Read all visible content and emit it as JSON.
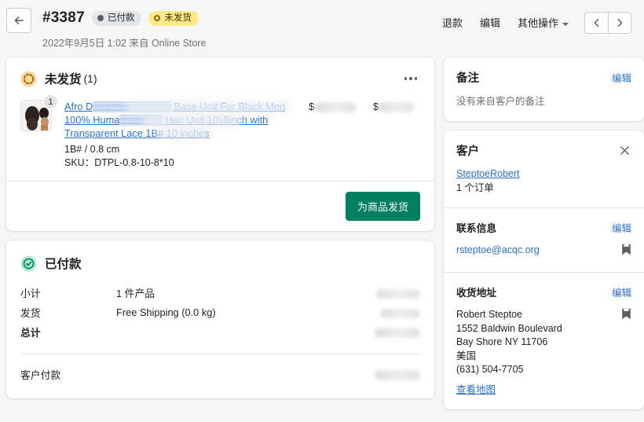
{
  "header": {
    "back_label": "返回",
    "order_number": "#3387",
    "badge_paid": "已付款",
    "badge_unfulfilled": "未发货",
    "date_line": "2022年9月5日 1:02 来自 Online Store",
    "actions": {
      "refund": "退款",
      "edit": "编辑",
      "more": "其他操作"
    },
    "prev_label": "上一个订单",
    "next_label": "下一个订单"
  },
  "fulfillment": {
    "title": "未发货",
    "count": "(1)",
    "status_icon": "dashed-circle-icon",
    "more_icon": "ellipsis-icon",
    "item": {
      "title": "Afro D▒▒▒▒▒▒▒▒▒▒▒ Base Unit For Black Men 100% Huma▒▒▒▒▒▒ Hair Unit 10x8inch with Transparent Lace 1B# 10 inches",
      "variant": "1B# / 0.8 cm",
      "sku": "SKU：DTPL-0.8-10-8*10",
      "quantity": "1",
      "price_currency": "$",
      "price_value": "",
      "total_currency": "$",
      "total_value": ""
    },
    "fulfill_button": "为商品发货"
  },
  "paid": {
    "title": "已付款",
    "status_icon": "check-circle-icon",
    "rows": [
      {
        "label": "小计",
        "detail": "1 件产品",
        "amount": ""
      },
      {
        "label": "发货",
        "detail": "Free Shipping (0.0 kg)",
        "amount": ""
      },
      {
        "label": "总计",
        "detail": "",
        "amount": ""
      }
    ],
    "customer_paid_label": "客户付款",
    "customer_paid_amount": ""
  },
  "sidebar": {
    "notes": {
      "title": "备注",
      "edit": "编辑",
      "empty_text": "没有来自客户的备注"
    },
    "customer": {
      "title": "客户",
      "close_icon": "close-icon",
      "name": "SteptoeRobert",
      "orders": "1 个订单"
    },
    "contact": {
      "title": "联系信息",
      "edit": "编辑",
      "email": "rsteptoe@acqc.org",
      "copy_icon": "copy-icon"
    },
    "shipping": {
      "title": "收货地址",
      "edit": "编辑",
      "copy_icon": "copy-icon",
      "lines": [
        "Robert Steptoe",
        "1552 Baldwin Boulevard",
        "Bay Shore NY 11706",
        "美国",
        "(631) 504-7705"
      ],
      "map_link": "查看地图"
    }
  },
  "colors": {
    "background": "#f6f6f7",
    "card": "#ffffff",
    "primary_button": "#008060",
    "link": "#2c6ecb",
    "badge_unfulfilled_bg": "#ffea8a",
    "badge_paid_bg": "#e4e5e7",
    "text": "#202223",
    "muted_text": "#6d7175"
  }
}
